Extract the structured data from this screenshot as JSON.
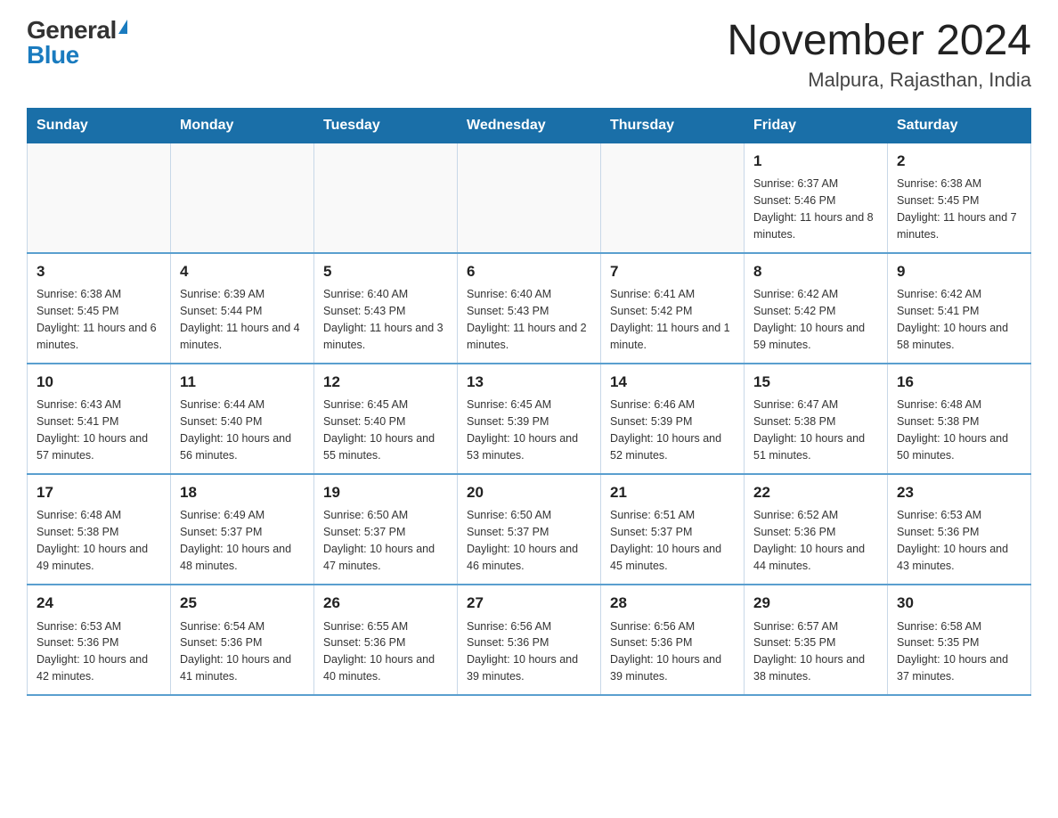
{
  "logo": {
    "general": "General",
    "blue": "Blue"
  },
  "title": "November 2024",
  "subtitle": "Malpura, Rajasthan, India",
  "days_of_week": [
    "Sunday",
    "Monday",
    "Tuesday",
    "Wednesday",
    "Thursday",
    "Friday",
    "Saturday"
  ],
  "weeks": [
    [
      {
        "day": "",
        "info": ""
      },
      {
        "day": "",
        "info": ""
      },
      {
        "day": "",
        "info": ""
      },
      {
        "day": "",
        "info": ""
      },
      {
        "day": "",
        "info": ""
      },
      {
        "day": "1",
        "info": "Sunrise: 6:37 AM\nSunset: 5:46 PM\nDaylight: 11 hours and 8 minutes."
      },
      {
        "day": "2",
        "info": "Sunrise: 6:38 AM\nSunset: 5:45 PM\nDaylight: 11 hours and 7 minutes."
      }
    ],
    [
      {
        "day": "3",
        "info": "Sunrise: 6:38 AM\nSunset: 5:45 PM\nDaylight: 11 hours and 6 minutes."
      },
      {
        "day": "4",
        "info": "Sunrise: 6:39 AM\nSunset: 5:44 PM\nDaylight: 11 hours and 4 minutes."
      },
      {
        "day": "5",
        "info": "Sunrise: 6:40 AM\nSunset: 5:43 PM\nDaylight: 11 hours and 3 minutes."
      },
      {
        "day": "6",
        "info": "Sunrise: 6:40 AM\nSunset: 5:43 PM\nDaylight: 11 hours and 2 minutes."
      },
      {
        "day": "7",
        "info": "Sunrise: 6:41 AM\nSunset: 5:42 PM\nDaylight: 11 hours and 1 minute."
      },
      {
        "day": "8",
        "info": "Sunrise: 6:42 AM\nSunset: 5:42 PM\nDaylight: 10 hours and 59 minutes."
      },
      {
        "day": "9",
        "info": "Sunrise: 6:42 AM\nSunset: 5:41 PM\nDaylight: 10 hours and 58 minutes."
      }
    ],
    [
      {
        "day": "10",
        "info": "Sunrise: 6:43 AM\nSunset: 5:41 PM\nDaylight: 10 hours and 57 minutes."
      },
      {
        "day": "11",
        "info": "Sunrise: 6:44 AM\nSunset: 5:40 PM\nDaylight: 10 hours and 56 minutes."
      },
      {
        "day": "12",
        "info": "Sunrise: 6:45 AM\nSunset: 5:40 PM\nDaylight: 10 hours and 55 minutes."
      },
      {
        "day": "13",
        "info": "Sunrise: 6:45 AM\nSunset: 5:39 PM\nDaylight: 10 hours and 53 minutes."
      },
      {
        "day": "14",
        "info": "Sunrise: 6:46 AM\nSunset: 5:39 PM\nDaylight: 10 hours and 52 minutes."
      },
      {
        "day": "15",
        "info": "Sunrise: 6:47 AM\nSunset: 5:38 PM\nDaylight: 10 hours and 51 minutes."
      },
      {
        "day": "16",
        "info": "Sunrise: 6:48 AM\nSunset: 5:38 PM\nDaylight: 10 hours and 50 minutes."
      }
    ],
    [
      {
        "day": "17",
        "info": "Sunrise: 6:48 AM\nSunset: 5:38 PM\nDaylight: 10 hours and 49 minutes."
      },
      {
        "day": "18",
        "info": "Sunrise: 6:49 AM\nSunset: 5:37 PM\nDaylight: 10 hours and 48 minutes."
      },
      {
        "day": "19",
        "info": "Sunrise: 6:50 AM\nSunset: 5:37 PM\nDaylight: 10 hours and 47 minutes."
      },
      {
        "day": "20",
        "info": "Sunrise: 6:50 AM\nSunset: 5:37 PM\nDaylight: 10 hours and 46 minutes."
      },
      {
        "day": "21",
        "info": "Sunrise: 6:51 AM\nSunset: 5:37 PM\nDaylight: 10 hours and 45 minutes."
      },
      {
        "day": "22",
        "info": "Sunrise: 6:52 AM\nSunset: 5:36 PM\nDaylight: 10 hours and 44 minutes."
      },
      {
        "day": "23",
        "info": "Sunrise: 6:53 AM\nSunset: 5:36 PM\nDaylight: 10 hours and 43 minutes."
      }
    ],
    [
      {
        "day": "24",
        "info": "Sunrise: 6:53 AM\nSunset: 5:36 PM\nDaylight: 10 hours and 42 minutes."
      },
      {
        "day": "25",
        "info": "Sunrise: 6:54 AM\nSunset: 5:36 PM\nDaylight: 10 hours and 41 minutes."
      },
      {
        "day": "26",
        "info": "Sunrise: 6:55 AM\nSunset: 5:36 PM\nDaylight: 10 hours and 40 minutes."
      },
      {
        "day": "27",
        "info": "Sunrise: 6:56 AM\nSunset: 5:36 PM\nDaylight: 10 hours and 39 minutes."
      },
      {
        "day": "28",
        "info": "Sunrise: 6:56 AM\nSunset: 5:36 PM\nDaylight: 10 hours and 39 minutes."
      },
      {
        "day": "29",
        "info": "Sunrise: 6:57 AM\nSunset: 5:35 PM\nDaylight: 10 hours and 38 minutes."
      },
      {
        "day": "30",
        "info": "Sunrise: 6:58 AM\nSunset: 5:35 PM\nDaylight: 10 hours and 37 minutes."
      }
    ]
  ]
}
